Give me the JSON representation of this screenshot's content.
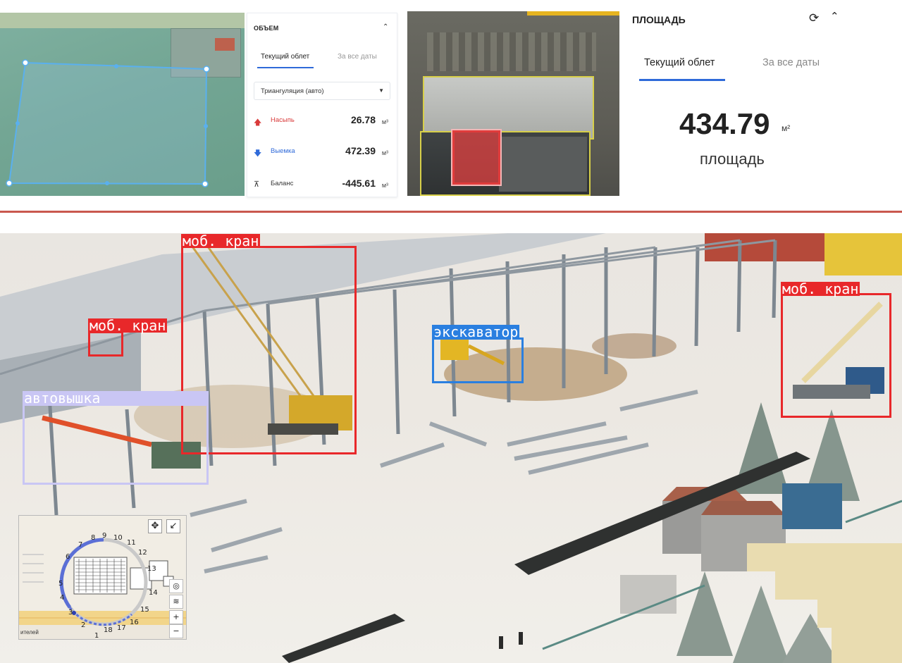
{
  "volume_panel": {
    "title": "ОБЪЕМ",
    "tabs": [
      "Текущий облет",
      "За все даты"
    ],
    "method_select": "Триангуляция (авто)",
    "rows": [
      {
        "icon": "arrow-up-icon",
        "label": "Насыпь",
        "value": "26.78",
        "unit": "м³",
        "color": "#d93a3a"
      },
      {
        "icon": "arrow-down-icon",
        "label": "Выемка",
        "value": "472.39",
        "unit": "м³",
        "color": "#2f6ad9"
      },
      {
        "icon": "balance-icon",
        "label": "Баланс",
        "value": "-445.61",
        "unit": "м³",
        "color": "#333333"
      }
    ]
  },
  "area_panel": {
    "title": "ПЛОЩАДЬ",
    "tabs": [
      "Текущий облет",
      "За все даты"
    ],
    "value": "434.79",
    "unit": "м²",
    "label": "площадь"
  },
  "detections": [
    {
      "label": "моб. кран",
      "color": "#e8282a"
    },
    {
      "label": "моб. кран",
      "color": "#e8282a"
    },
    {
      "label": "экскаватор",
      "color": "#2a7fe0"
    },
    {
      "label": "автовышка",
      "color": "#c9c6f4"
    },
    {
      "label": "моб. кран",
      "color": "#e8282a"
    }
  ],
  "minimap": {
    "numbers": [
      "1",
      "2",
      "3",
      "4",
      "5",
      "6",
      "7",
      "8",
      "9",
      "10",
      "11",
      "12",
      "13",
      "14",
      "15",
      "16",
      "17",
      "18"
    ],
    "street": "ителей",
    "zoom_in": "+",
    "zoom_out": "−"
  },
  "colors": {
    "accent": "#2f6ad9",
    "divider": "#c9584e"
  }
}
